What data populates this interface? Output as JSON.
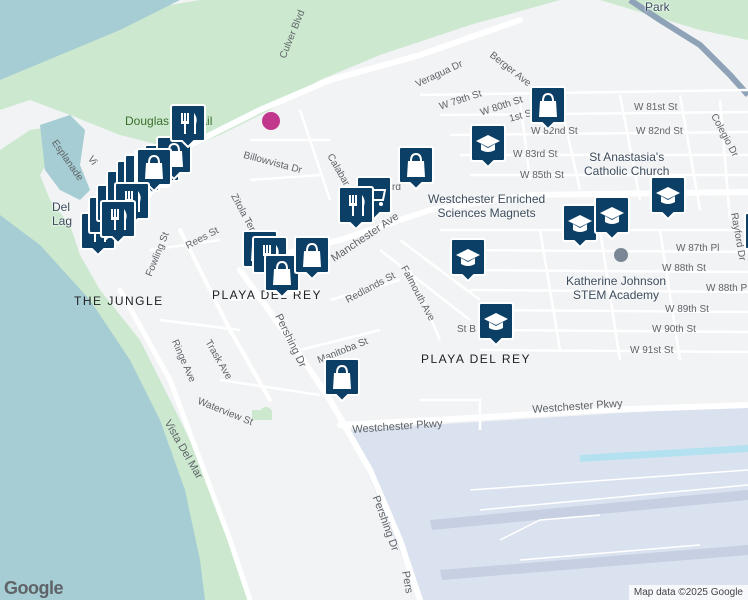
{
  "map": {
    "neighborhoods": [
      "PLAYA DEL REY",
      "THE JUNGLE",
      "PLAYA DEL REY"
    ],
    "streets": {
      "culver_blvd": "Culver Blvd",
      "veragua_dr": "Veragua Dr",
      "berger_ave": "Berger Ave",
      "w79th": "W 79th St",
      "w80th": "W 80th St",
      "w81st": "W 81st St",
      "w81st_partial": "1st St",
      "w82nd_a": "W 82nd St",
      "w82nd_b": "W 82nd St",
      "w83rd": "W 83rd St",
      "w85th": "W 85th St",
      "w87th": "W 87th Pl",
      "w88th": "W 88th St",
      "w88th_partial": "W 88th P",
      "w89th": "W 89th St",
      "w90th": "W 90th St",
      "w91st": "W 91st St",
      "colegio": "Colegio Dr",
      "rayford": "Rayford Dr",
      "billowvista": "Billowvista Dr",
      "calabar": "Calabar",
      "calabar_partial": "rd",
      "manchester": "W Manchester Ave",
      "ziola": "Zitola Ter",
      "rees": "Rees St",
      "fowling": "Fowling St",
      "esplanade": "Esplanade",
      "vista": "Vi",
      "redlands": "Redlands St",
      "falmouth": "Falmouth Ave",
      "st_b": "St B",
      "manitoba": "Manitoba St",
      "pershing_a": "Pershing Dr",
      "pershing_b": "Pershing Dr",
      "pershing_c": "Pers",
      "ringe": "Ringe Ave",
      "trask": "Trask Ave",
      "waterview": "Waterview St",
      "vista_del_mar": "Vista Del Mar",
      "westchester_pkwy_a": "Westchester Pkwy",
      "westchester_pkwy_b": "Westchester Pkwy"
    },
    "pois": {
      "douglas_trail": "Douglas Fir Trail",
      "st_anastasia": "St Anastasia's\nCatholic Church",
      "westchester_magnets": "Westchester Enriched\nSciences Magnets",
      "katherine_johnson": "Katherine Johnson\nSTEM Academy",
      "del_lag": "Del\nLag",
      "park": "Park"
    },
    "markers": [
      {
        "type": "restaurant"
      },
      {
        "type": "restaurant"
      },
      {
        "type": "restaurant"
      },
      {
        "type": "shop"
      },
      {
        "type": "shop"
      },
      {
        "type": "restaurant"
      },
      {
        "type": "restaurant"
      },
      {
        "type": "shop"
      },
      {
        "type": "shop"
      },
      {
        "type": "restaurant"
      },
      {
        "type": "shop"
      },
      {
        "type": "restaurant"
      },
      {
        "type": "restaurant"
      },
      {
        "type": "shop"
      },
      {
        "type": "restaurant"
      },
      {
        "type": "shop"
      },
      {
        "type": "shop"
      },
      {
        "type": "grocery"
      },
      {
        "type": "shop"
      },
      {
        "type": "school"
      },
      {
        "type": "school"
      },
      {
        "type": "school"
      },
      {
        "type": "school"
      },
      {
        "type": "school"
      },
      {
        "type": "school"
      },
      {
        "type": "school"
      },
      {
        "type": "shop"
      },
      {
        "type": "shop"
      },
      {
        "type": "restaurant"
      }
    ],
    "colors": {
      "water": "#a5cdd3",
      "land": "#f1f3f4",
      "park": "#c8e6c9",
      "marker": "#0c3f66",
      "airport": "#dbe2ef"
    },
    "attribution": "Map data ©2025 Google",
    "logo": "Google"
  }
}
